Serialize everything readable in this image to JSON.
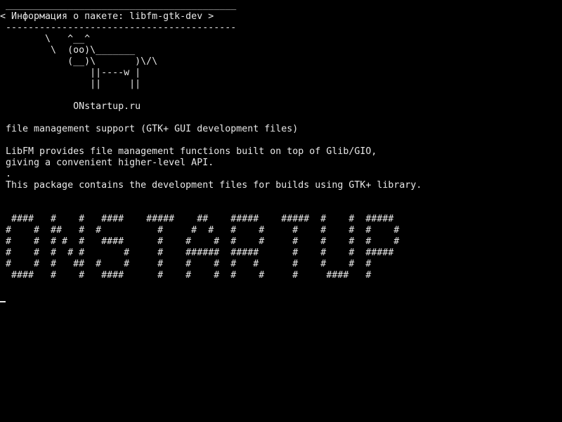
{
  "terminal": {
    "lines": [
      " _________________________________________",
      "< Информация о пакете: libfm-gtk-dev >",
      " -----------------------------------------",
      "        \\   ^__^",
      "         \\  (oo)\\_______",
      "            (__)\\       )\\/\\",
      "                ||----w |",
      "                ||     ||",
      "",
      "             ONstartup.ru",
      "",
      " file management support (GTK+ GUI development files)",
      "",
      " LibFM provides file management functions built on top of Glib/GIO,",
      " giving a convenient higher-level API.",
      " .",
      " This package contains the development files for builds using GTK+ library.",
      "",
      "",
      "  ####   #    #   ####    #####    ##    #####    #####  #    #  #####",
      " #    #  ##   #  #          #     #  #   #    #     #    #    #  #    #",
      " #    #  # #  #   ####      #    #    #  #    #     #    #    #  #    #",
      " #    #  #  # #       #     #    ######  #####      #    #    #  #####",
      " #    #  #   ##  #    #     #    #    #  #   #      #    #    #  #",
      "  ####   #    #   ####      #    #    #  #    #     #     ####   #"
    ],
    "colors": {
      "background": "#000000",
      "foreground": "#e8e8e8"
    }
  }
}
